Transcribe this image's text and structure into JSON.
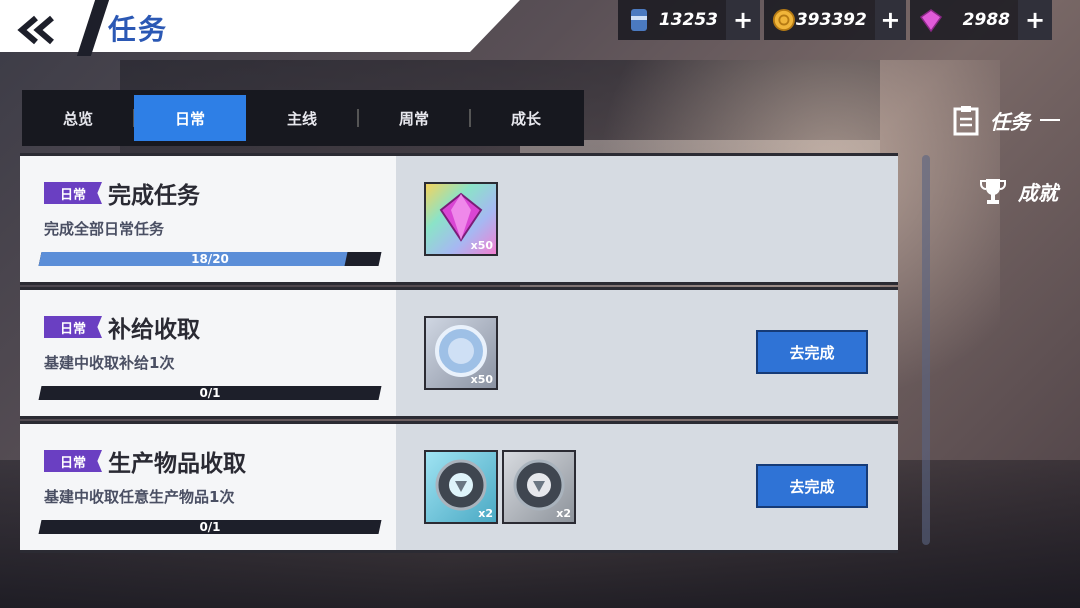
{
  "header": {
    "title": "任务"
  },
  "currencies": [
    {
      "name": "oil-icon",
      "value": "13253"
    },
    {
      "name": "coin-icon",
      "value": "393392"
    },
    {
      "name": "gem-icon",
      "value": "2988"
    }
  ],
  "tabs": [
    "总览",
    "日常",
    "主线",
    "周常",
    "成长"
  ],
  "side_menu": {
    "tasks": "任务",
    "achievements": "成就"
  },
  "tasks": [
    {
      "tag": "日常",
      "title": "完成任务",
      "desc": "完成全部日常任务",
      "progress_text": "18/20",
      "progress": 0.9,
      "rewards": [
        {
          "icon": "gem-icon",
          "qty": "x50"
        }
      ],
      "button": ""
    },
    {
      "tag": "日常",
      "title": "补给收取",
      "desc": "基建中收取补给1次",
      "progress_text": "0/1",
      "progress": 0,
      "rewards": [
        {
          "icon": "silver-medal-icon",
          "qty": "x50"
        }
      ],
      "button": "去完成"
    },
    {
      "tag": "日常",
      "title": "生产物品收取",
      "desc": "基建中收取任意生产物品1次",
      "progress_text": "0/1",
      "progress": 0,
      "rewards": [
        {
          "icon": "core-blue-icon",
          "qty": "x2"
        },
        {
          "icon": "core-grey-icon",
          "qty": "x2"
        }
      ],
      "button": "去完成"
    }
  ],
  "colors": {
    "accent": "#2e7fe6",
    "tag": "#6a3fc2",
    "title": "#2b58b4"
  }
}
